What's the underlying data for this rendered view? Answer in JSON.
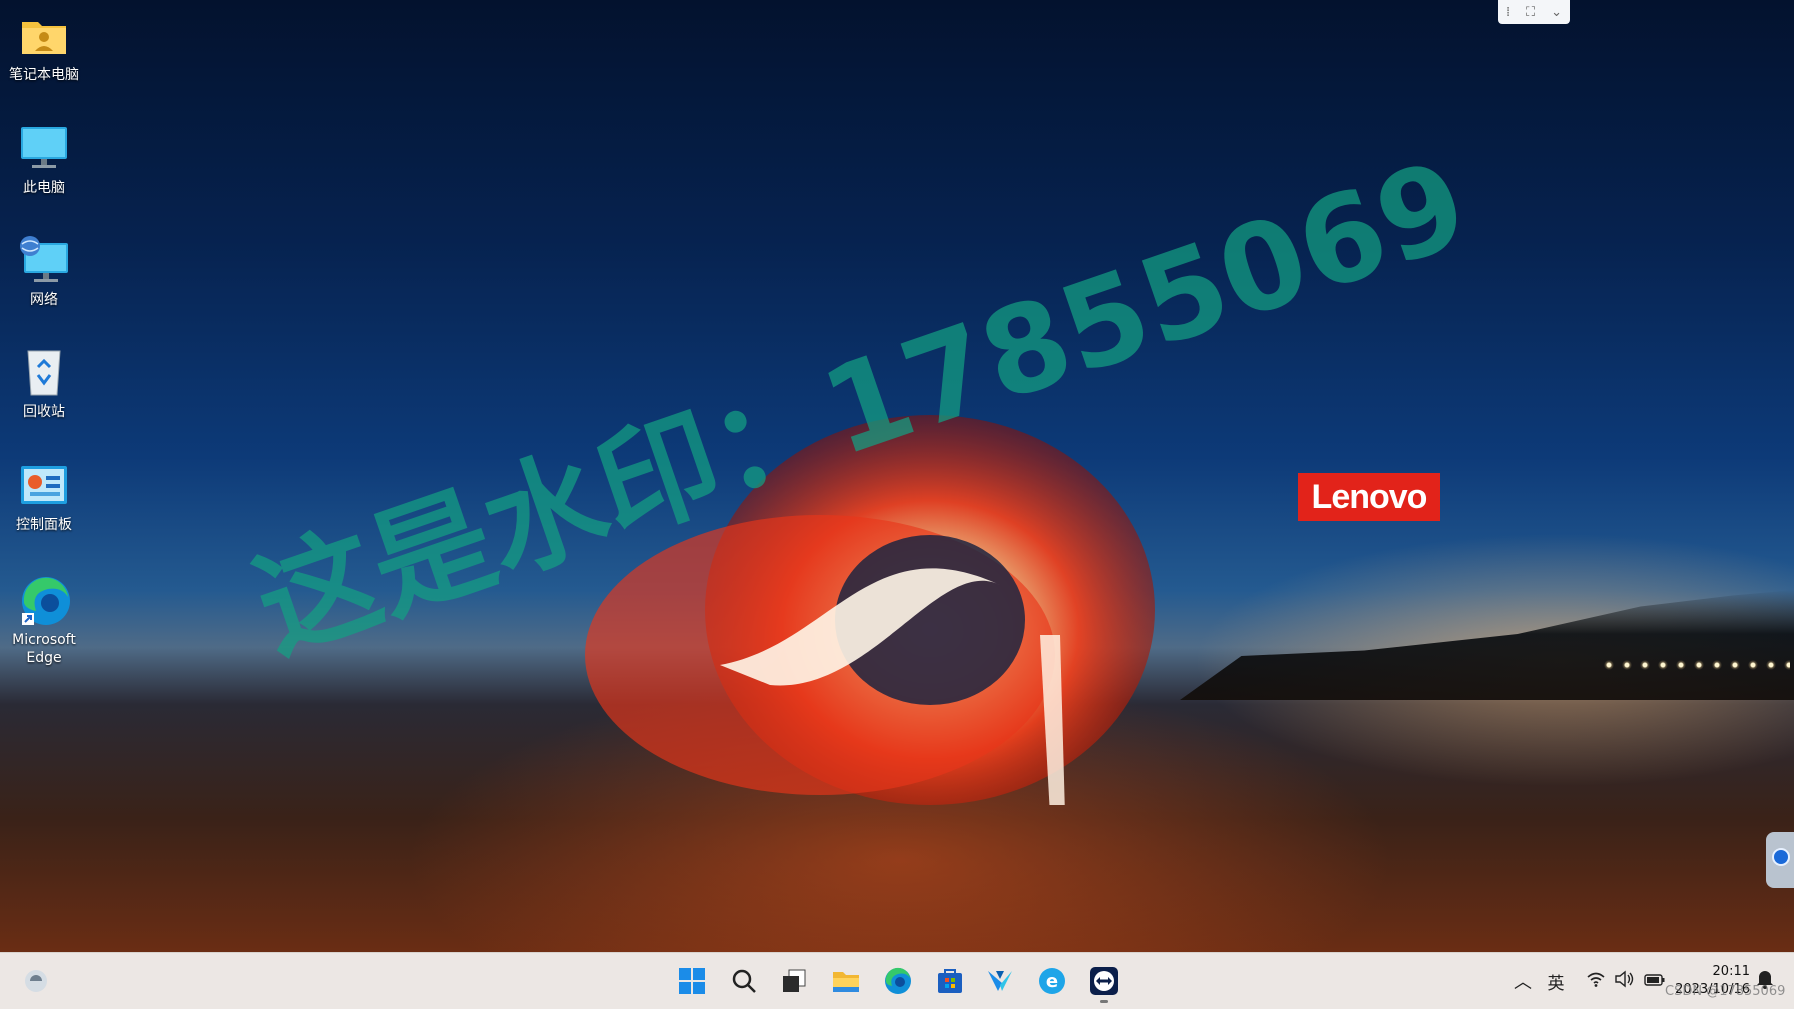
{
  "desktop_icons": [
    {
      "label": "笔记本电脑",
      "icon": "user-folder-icon"
    },
    {
      "label": "此电脑",
      "icon": "monitor-icon"
    },
    {
      "label": "网络",
      "icon": "network-globe-icon"
    },
    {
      "label": "回收站",
      "icon": "recycle-bin-icon"
    },
    {
      "label": "控制面板",
      "icon": "control-panel-icon"
    },
    {
      "label": "Microsoft\nEdge",
      "icon": "edge-icon"
    }
  ],
  "wallpaper": {
    "brand": "Lenovo",
    "brand_color": "#e2231a"
  },
  "watermark": "这是水印：17855069",
  "remote_toolbar": {
    "icons": [
      "drag-handle-icon",
      "fullscreen-icon",
      "chevron-down-icon"
    ]
  },
  "taskbar": {
    "widget_icon": "weather-widget-icon",
    "apps": [
      {
        "name": "start-button",
        "icon": "windows-logo-icon"
      },
      {
        "name": "search-button",
        "icon": "search-icon"
      },
      {
        "name": "task-view-button",
        "icon": "task-view-icon"
      },
      {
        "name": "file-explorer-button",
        "icon": "folder-icon"
      },
      {
        "name": "edge-button",
        "icon": "edge-icon"
      },
      {
        "name": "store-button",
        "icon": "store-icon"
      },
      {
        "name": "app-v-button",
        "icon": "v-app-icon"
      },
      {
        "name": "ie-button",
        "icon": "ie-icon"
      },
      {
        "name": "teamviewer-button",
        "icon": "teamviewer-icon"
      }
    ],
    "tray": {
      "overflow_icon": "chevron-up-icon",
      "ime": "英",
      "clock_time": "20:11",
      "clock_date": "2023/10/16"
    }
  },
  "csdn_watermark": "CSDN @17855069"
}
